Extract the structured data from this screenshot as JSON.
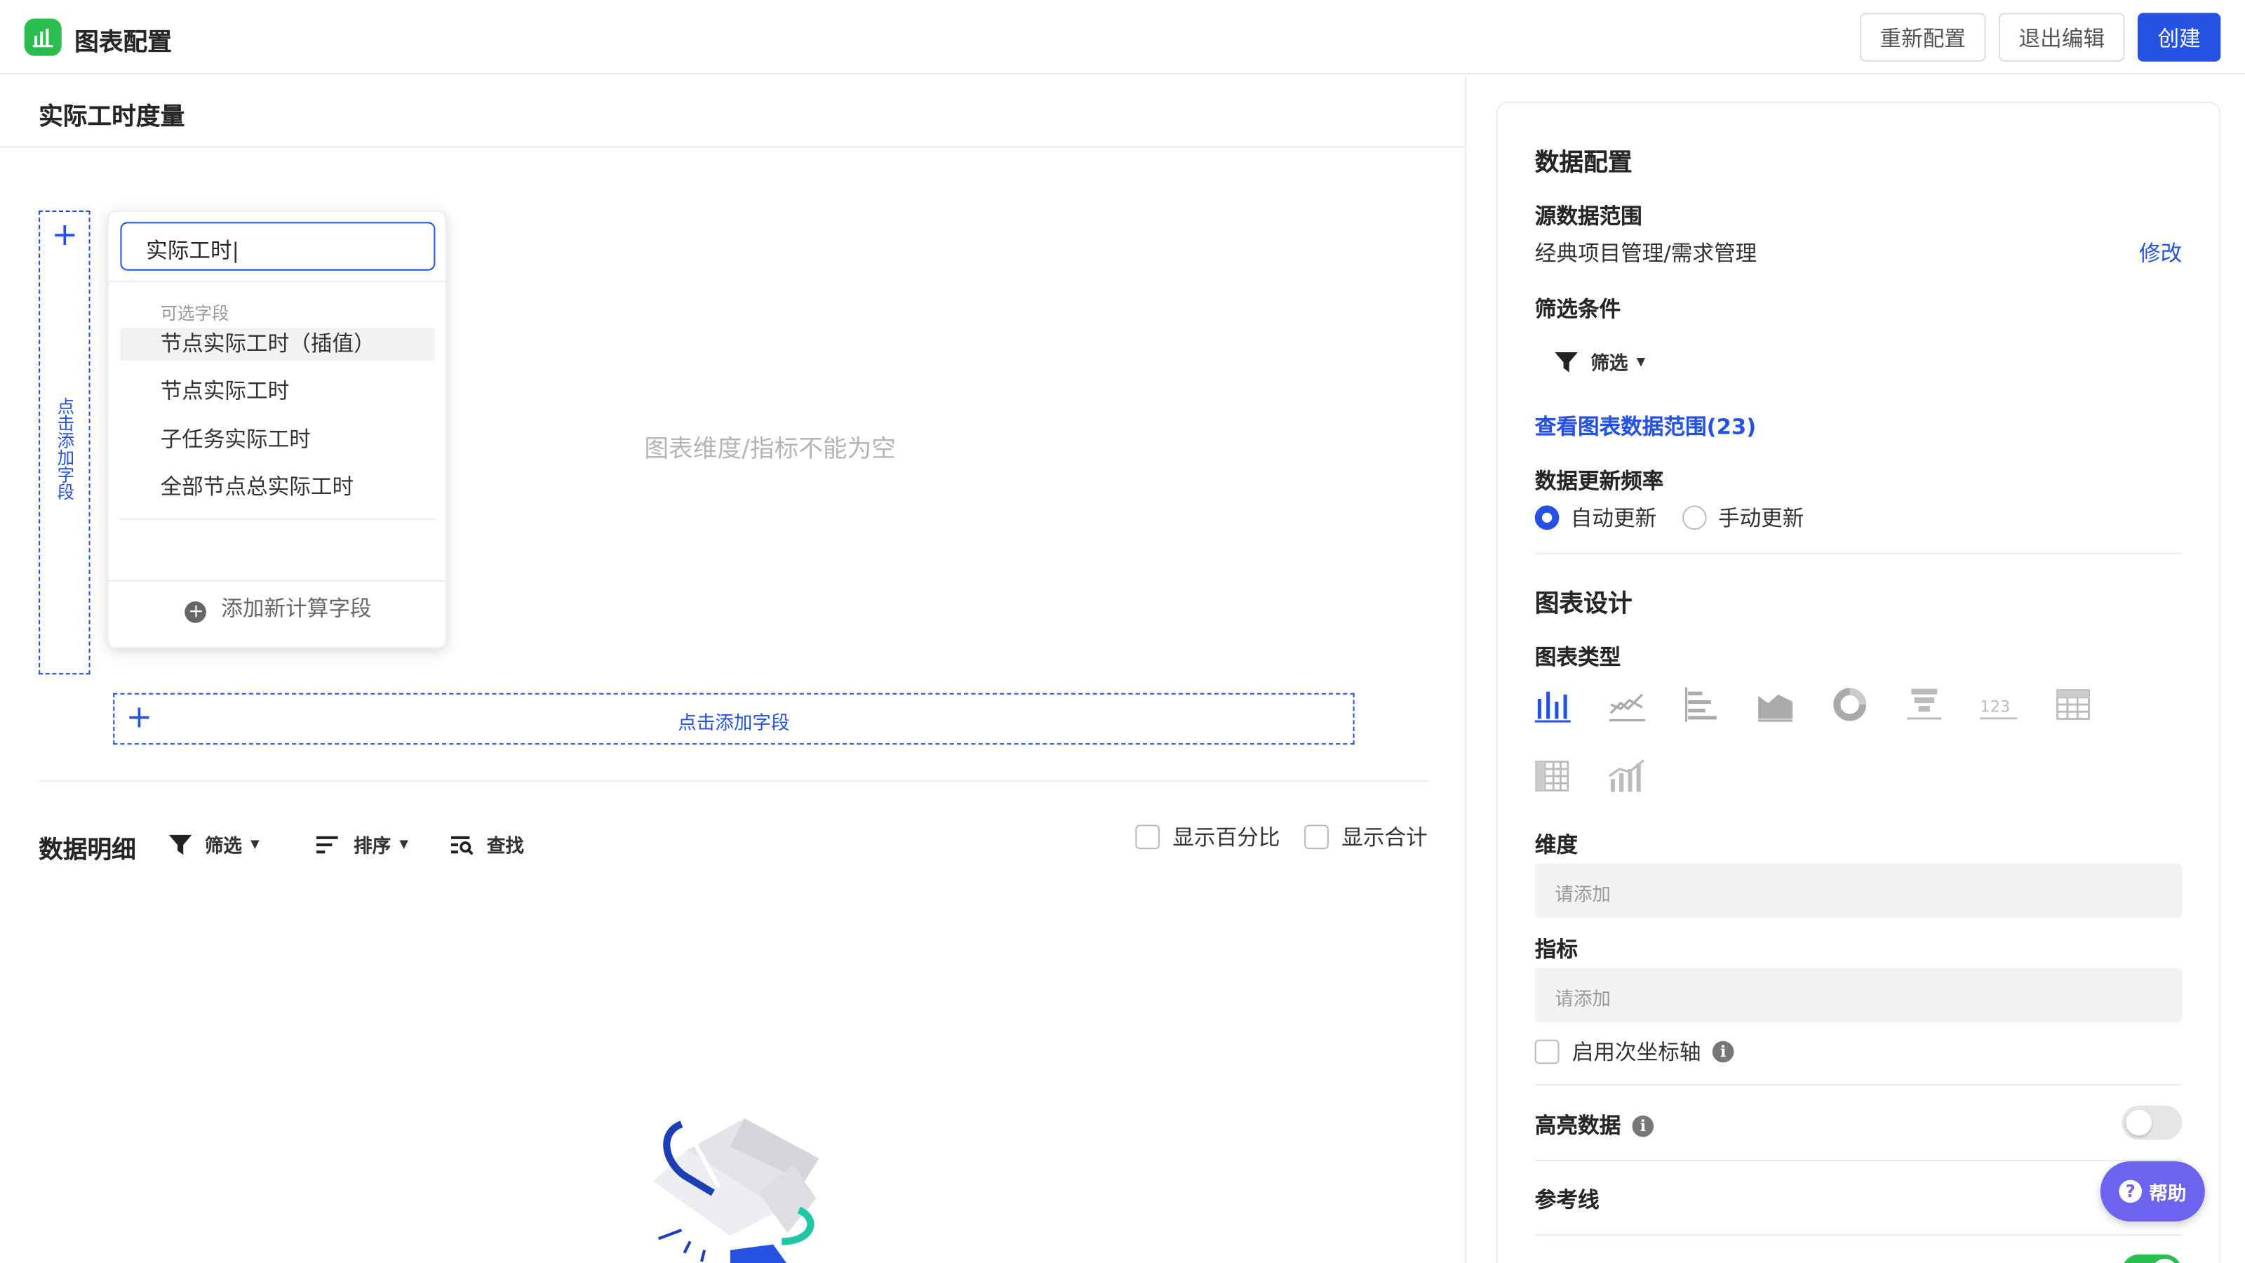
{
  "topbar": {
    "title": "图表配置",
    "reset_label": "重新配置",
    "exit_label": "退出编辑",
    "create_label": "创建",
    "accent_color": "#2552e3",
    "logo_color": "#2cbd4f"
  },
  "editor": {
    "chart_title": "实际工时度量",
    "add_field_vertical": "点击添加字段",
    "add_field_horizontal": "点击添加字段",
    "empty_message": "图表维度/指标不能为空"
  },
  "field_dropdown": {
    "search_value": "实际工时",
    "group_label": "可选字段",
    "items": [
      "节点实际工时（插值）",
      "节点实际工时",
      "子任务实际工时",
      "全部节点总实际工时"
    ],
    "highlighted_index": 0,
    "add_calc_label": "添加新计算字段"
  },
  "details": {
    "title": "数据明细",
    "filter_label": "筛选",
    "sort_label": "排序",
    "find_label": "查找",
    "show_percent_label": "显示百分比",
    "show_percent_checked": false,
    "show_total_label": "显示合计",
    "show_total_checked": false
  },
  "data_config": {
    "title": "数据配置",
    "source_label": "源数据范围",
    "source_value": "经典项目管理/需求管理",
    "edit_label": "修改",
    "filter_section_label": "筛选条件",
    "filter_button_label": "筛选",
    "view_range_label": "查看图表数据范围(23)",
    "update_freq_label": "数据更新频率",
    "auto_update_label": "自动更新",
    "manual_update_label": "手动更新",
    "selected_update": "auto"
  },
  "chart_design": {
    "title": "图表设计",
    "type_label": "图表类型",
    "chart_types": [
      "bar-chart-icon",
      "line-chart-icon",
      "horizontal-bar-icon",
      "area-chart-icon",
      "donut-chart-icon",
      "funnel-chart-icon",
      "number-card-icon",
      "table-icon",
      "pivot-table-icon",
      "combo-chart-icon"
    ],
    "selected_type": "bar-chart-icon",
    "dimension_label": "维度",
    "dimension_placeholder": "请添加",
    "metric_label": "指标",
    "metric_placeholder": "请添加",
    "secondary_axis_label": "启用次坐标轴",
    "secondary_axis_checked": false,
    "highlight_label": "高亮数据",
    "highlight_on": false,
    "refline_label": "参考线"
  },
  "help": {
    "label": "帮助",
    "color": "#6c63ee"
  }
}
